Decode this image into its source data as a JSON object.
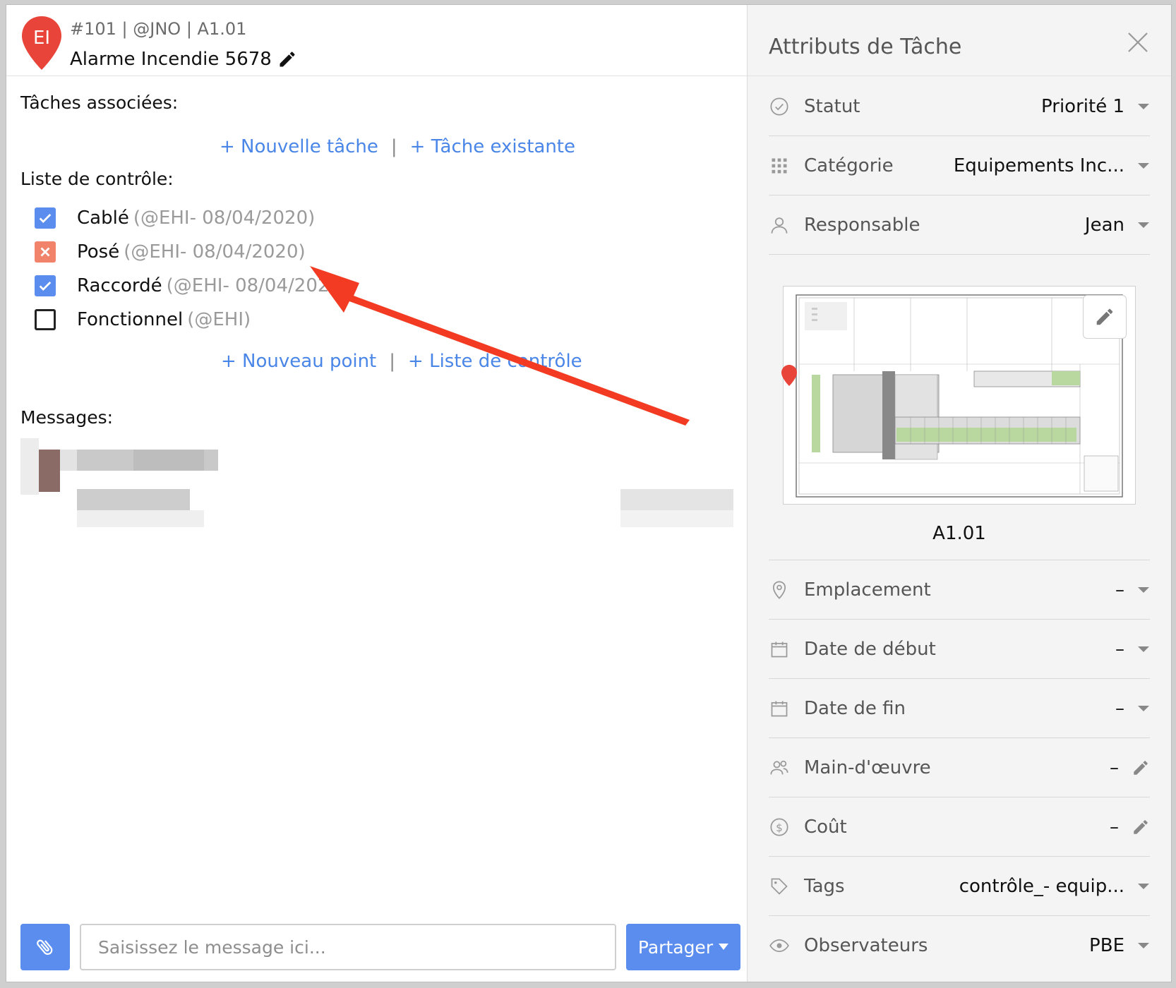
{
  "header": {
    "pin_initials": "EI",
    "meta": "#101 | @JNO | A1.01",
    "title": "Alarme Incendie 5678"
  },
  "associated": {
    "label": "Tâches associées:",
    "new_task": "+ Nouvelle tâche",
    "existing_task": "+ Tâche existante",
    "separator": "|"
  },
  "checklist": {
    "label": "Liste de contrôle:",
    "items": [
      {
        "label": "Cablé",
        "meta": "(@EHI- 08/04/2020)",
        "state": "checked"
      },
      {
        "label": "Posé",
        "meta": "(@EHI- 08/04/2020)",
        "state": "failed"
      },
      {
        "label": "Raccordé",
        "meta": "(@EHI- 08/04/2020)",
        "state": "checked"
      },
      {
        "label": "Fonctionnel",
        "meta": "(@EHI)",
        "state": "unchecked"
      }
    ],
    "new_point": "+ Nouveau point",
    "new_list": "+ Liste de contrôle",
    "separator": "|"
  },
  "messages": {
    "label": "Messages:"
  },
  "composer": {
    "placeholder": "Saisissez le message ici...",
    "share_label": "Partager"
  },
  "attributes": {
    "title": "Attributs de Tâche",
    "rows": [
      {
        "label": "Statut",
        "value": "Priorité 1",
        "icon": "check-circle-icon",
        "control": "caret"
      },
      {
        "label": "Catégorie",
        "value": "Equipements Inc...",
        "icon": "grid-icon",
        "control": "caret"
      },
      {
        "label": "Responsable",
        "value": "Jean",
        "icon": "user-icon",
        "control": "caret"
      },
      {
        "label": "Emplacement",
        "value": "–",
        "icon": "location-icon",
        "control": "caret"
      },
      {
        "label": "Date de début",
        "value": "–",
        "icon": "calendar-icon",
        "control": "caret"
      },
      {
        "label": "Date de fin",
        "value": "–",
        "icon": "calendar-icon",
        "control": "caret"
      },
      {
        "label": "Main-d'œuvre",
        "value": "–",
        "icon": "users-icon",
        "control": "pencil"
      },
      {
        "label": "Coût",
        "value": "–",
        "icon": "dollar-icon",
        "control": "pencil"
      },
      {
        "label": "Tags",
        "value": "contrôle_- equip...",
        "icon": "tag-icon",
        "control": "caret"
      },
      {
        "label": "Observateurs",
        "value": "PBE",
        "icon": "eye-icon",
        "control": "caret"
      }
    ],
    "plan_caption": "A1.01"
  },
  "colors": {
    "accent": "#5b8def",
    "link": "#4a86e8",
    "failed": "#f2836b",
    "pin": "#e8443a",
    "arrow": "#f23b22"
  }
}
